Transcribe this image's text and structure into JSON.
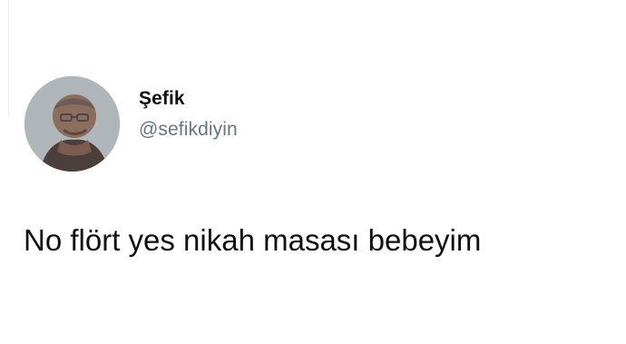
{
  "tweet": {
    "author": {
      "display_name": "Şefik",
      "handle": "@sefikdiyin"
    },
    "text": "No flört yes nikah masası bebeyim"
  }
}
